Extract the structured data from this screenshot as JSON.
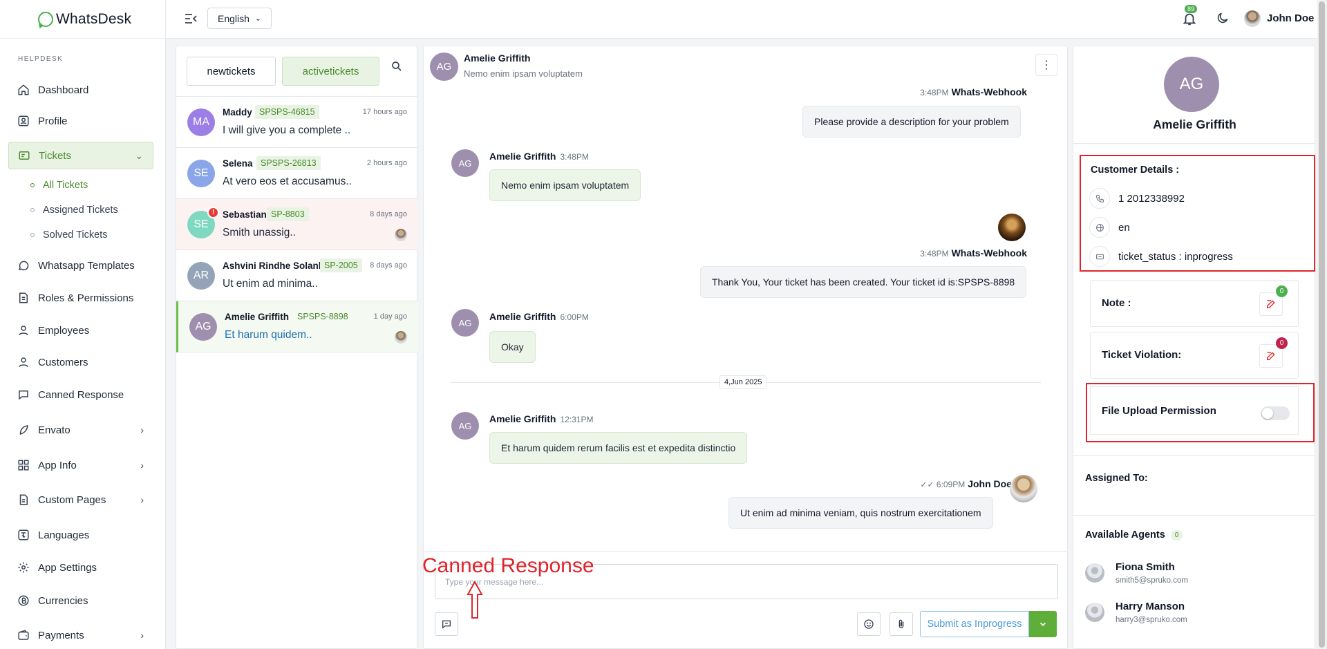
{
  "brand": {
    "name": "WhatsDesk"
  },
  "sidebar": {
    "section": "HELPDESK",
    "items": [
      {
        "label": "Dashboard",
        "icon": "home-icon"
      },
      {
        "label": "Profile",
        "icon": "profile-icon"
      },
      {
        "label": "Tickets",
        "icon": "ticket-icon",
        "active": true
      },
      {
        "label": "Whatsapp Templates",
        "icon": "whatsapp-icon"
      },
      {
        "label": "Roles & Permissions",
        "icon": "roles-icon"
      },
      {
        "label": "Employees",
        "icon": "user-icon"
      },
      {
        "label": "Customers",
        "icon": "user-icon"
      },
      {
        "label": "Canned Response",
        "icon": "chat-icon"
      },
      {
        "label": "Envato",
        "icon": "leaf-icon"
      },
      {
        "label": "App Info",
        "icon": "grid-icon"
      },
      {
        "label": "Custom Pages",
        "icon": "page-icon"
      },
      {
        "label": "Languages",
        "icon": "language-icon"
      },
      {
        "label": "App Settings",
        "icon": "gear-icon"
      },
      {
        "label": "Currencies",
        "icon": "currency-icon"
      },
      {
        "label": "Payments",
        "icon": "wallet-icon"
      }
    ],
    "ticket_sub": [
      "All Tickets",
      "Assigned Tickets",
      "Solved Tickets"
    ]
  },
  "topbar": {
    "language": "English",
    "notification_count": "89",
    "user_name": "John Doe"
  },
  "ticket_tabs": {
    "new": "newtickets",
    "active": "activetickets"
  },
  "tickets": [
    {
      "initials": "MA",
      "name": "Maddy",
      "id": "SPSPS-46815",
      "time": "17 hours ago",
      "message": "I will give you a complete ..",
      "color": "#9b7fe6"
    },
    {
      "initials": "SE",
      "name": "Selena",
      "id": "SPSPS-26813",
      "time": "2 hours ago",
      "message": "At vero eos et accusamus..",
      "color": "#8aa6e8"
    },
    {
      "initials": "SE",
      "name": "Sebastian",
      "id": "SP-8803",
      "time": "8 days ago",
      "message": "Smith unassig..",
      "color": "#7fd9c0"
    },
    {
      "initials": "AR",
      "name": "Ashvini Rindhe Solank..",
      "id": "SP-2005",
      "time": "8 days ago",
      "message": "Ut enim ad minima..",
      "color": "#94a3b8"
    },
    {
      "initials": "AG",
      "name": "Amelie Griffith",
      "id": "SPSPS-8898",
      "time": "1 day ago",
      "message": "Et harum quidem..",
      "color": "#9e8fae"
    }
  ],
  "chat": {
    "customer_initials": "AG",
    "customer_name": "Amelie Griffith",
    "customer_sub": "Nemo enim ipsam voluptatem",
    "messages": {
      "m1_time": "3:48PM",
      "m1_sender": "Whats-Webhook",
      "m1_text": "Please provide a description for your problem",
      "m2_name": "Amelie Griffith",
      "m2_time": "3:48PM",
      "m2_text": "Nemo enim ipsam voluptatem",
      "m3_time": "3:48PM",
      "m3_sender": "Whats-Webhook",
      "m3_text": "Thank You, Your ticket has been created. Your ticket id is:SPSPS-8898",
      "m4_name": "Amelie Griffith",
      "m4_time": "6:00PM",
      "m4_text": "Okay",
      "date": "4,Jun 2025",
      "m5_name": "Amelie Griffith",
      "m5_time": "12:31PM",
      "m5_text": "Et harum quidem rerum facilis est et expedita distinctio",
      "m6_time": "6:09PM",
      "m6_sender": "John Doe",
      "m6_text": "Ut enim ad minima veniam, quis nostrum exercitationem"
    },
    "composer_placeholder": "Type your message here...",
    "annotation": "Canned Response",
    "submit_label": "Submit as Inprogress"
  },
  "customer_panel": {
    "initials": "AG",
    "name": "Amelie Griffith",
    "details_title": "Customer Details :",
    "phone": "1 2012338992",
    "language": "en",
    "status": "ticket_status : inprogress",
    "note_label": "Note :",
    "note_count": "0",
    "violation_label": "Ticket Violation:",
    "violation_count": "0",
    "upload_label": "File Upload Permission",
    "upload_enabled": false,
    "assigned_label": "Assigned To:",
    "agents_label": "Available Agents",
    "agents_count": "0",
    "agents": [
      {
        "name": "Fiona Smith",
        "email": "smith5@spruko.com"
      },
      {
        "name": "Harry Manson",
        "email": "harry3@spruko.com"
      }
    ]
  },
  "colors": {
    "accent": "#4caf50",
    "annotation": "#e0242b",
    "badge_red": "#c0234b"
  }
}
